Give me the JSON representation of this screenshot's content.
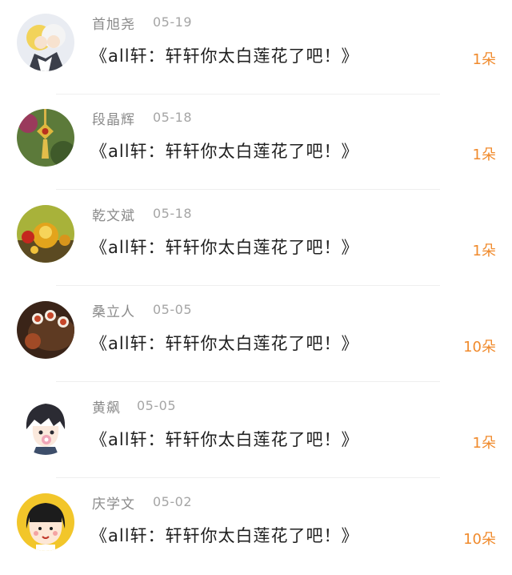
{
  "gift_list": [
    {
      "name": "首旭尧",
      "date": "05-19",
      "title": "《all轩：轩轩你太白莲花了吧！》",
      "count": "1朵",
      "avatar_icon": "anime-couple-avatar-icon"
    },
    {
      "name": "段晶辉",
      "date": "05-18",
      "title": "《all轩：轩轩你太白莲花了吧！》",
      "count": "1朵",
      "avatar_icon": "chinese-knot-avatar-icon"
    },
    {
      "name": "乾文斌",
      "date": "05-18",
      "title": "《all轩：轩轩你太白莲花了吧！》",
      "count": "1朵",
      "avatar_icon": "golden-ornaments-avatar-icon"
    },
    {
      "name": "桑立人",
      "date": "05-05",
      "title": "《all轩：轩轩你太白莲花了吧！》",
      "count": "10朵",
      "avatar_icon": "tea-cups-avatar-icon"
    },
    {
      "name": "黄飙",
      "date": "05-05",
      "title": "《all轩：轩轩你太白莲花了吧！》",
      "count": "1朵",
      "avatar_icon": "cartoon-boy-avatar-icon"
    },
    {
      "name": "庆学文",
      "date": "05-02",
      "title": "《all轩：轩轩你太白莲花了吧！》",
      "count": "10朵",
      "avatar_icon": "maruko-avatar-icon"
    }
  ],
  "colors": {
    "count_accent": "#f08a2c",
    "name_gray": "#8a8a8a",
    "title_text": "#1f1f1f"
  }
}
